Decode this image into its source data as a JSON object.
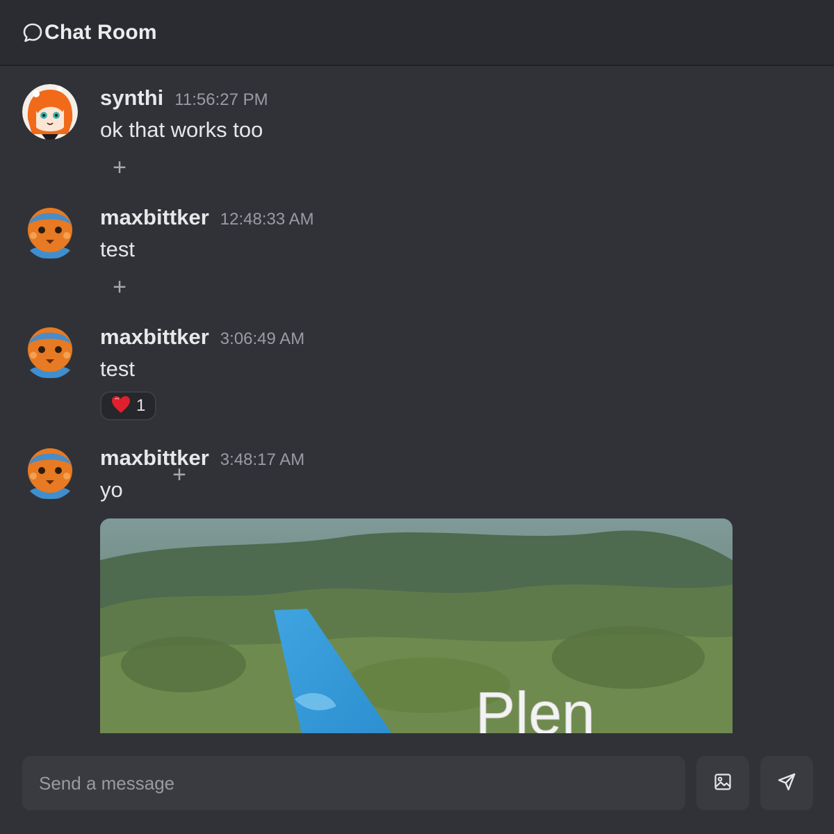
{
  "header": {
    "title": "Chat Room",
    "icon": "chat-bubble-icon"
  },
  "messages": [
    {
      "username": "synthi",
      "timestamp": "11:56:27 PM",
      "text": "ok that works too",
      "avatar": "anime-girl-avatar",
      "reactions": [],
      "add_reaction_label": "+"
    },
    {
      "username": "maxbittker",
      "timestamp": "12:48:33 AM",
      "text": "test",
      "avatar": "pixel-creature-avatar",
      "reactions": [],
      "add_reaction_label": "+"
    },
    {
      "username": "maxbittker",
      "timestamp": "3:06:49 AM",
      "text": "test",
      "avatar": "pixel-creature-avatar",
      "reactions": [
        {
          "emoji": "heart",
          "count": "1"
        }
      ],
      "add_reaction_label": "+"
    },
    {
      "username": "maxbittker",
      "timestamp": "3:48:17 AM",
      "text": "yo",
      "avatar": "pixel-creature-avatar",
      "attachment": {
        "type": "image",
        "caption_text": "Plen"
      }
    }
  ],
  "composer": {
    "placeholder": "Send a message",
    "value": ""
  },
  "buttons": {
    "attach_image_icon": "image-icon",
    "send_icon": "send-icon"
  },
  "colors": {
    "background": "#313238",
    "header": "#2b2c31",
    "input": "#3a3b41",
    "heart": "#e0202e",
    "plane_tail": "#3fa4e0"
  }
}
